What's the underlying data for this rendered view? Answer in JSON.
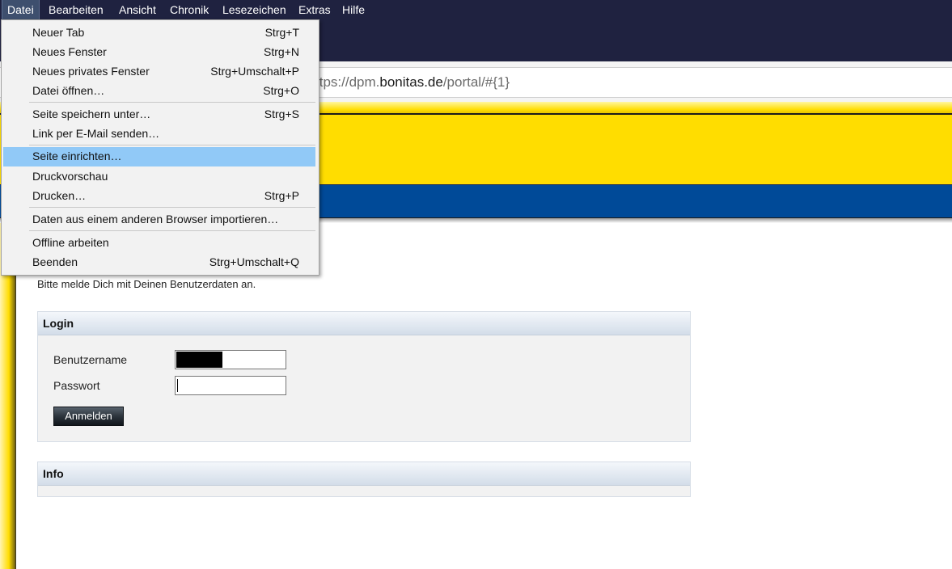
{
  "menubar": [
    "Datei",
    "Bearbeiten",
    "Ansicht",
    "Chronik",
    "Lesezeichen",
    "Extras",
    "Hilfe"
  ],
  "url": {
    "prefix": "ttps://dpm.",
    "domain": "bonitas.de",
    "path": "/portal/#{1}"
  },
  "file_menu": [
    {
      "label": "Neuer Tab",
      "shortcut": "Strg+T"
    },
    {
      "label": "Neues Fenster",
      "shortcut": "Strg+N"
    },
    {
      "label": "Neues privates Fenster",
      "shortcut": "Strg+Umschalt+P"
    },
    {
      "label": "Datei öffnen…",
      "shortcut": "Strg+O"
    },
    {
      "label": "Seite speichern unter…",
      "shortcut": "Strg+S"
    },
    {
      "label": "Link per E-Mail senden…",
      "shortcut": ""
    },
    {
      "label": "Seite einrichten…",
      "shortcut": ""
    },
    {
      "label": "Druckvorschau",
      "shortcut": ""
    },
    {
      "label": "Drucken…",
      "shortcut": "Strg+P"
    },
    {
      "label": "Daten aus einem anderen Browser importieren…",
      "shortcut": ""
    },
    {
      "label": "Offline arbeiten",
      "shortcut": ""
    },
    {
      "label": "Beenden",
      "shortcut": "Strg+Umschalt+Q"
    }
  ],
  "page": {
    "intro": "Bitte melde Dich mit Deinen Benutzerdaten an.",
    "login": {
      "title": "Login",
      "username_label": "Benutzername",
      "password_label": "Passwort",
      "submit": "Anmelden"
    },
    "info": {
      "title": "Info"
    }
  },
  "colors": {
    "yellow": "#ffdd00",
    "blue": "#004a98",
    "menu_highlight": "#91c9f7",
    "chrome": "#1f2240"
  }
}
